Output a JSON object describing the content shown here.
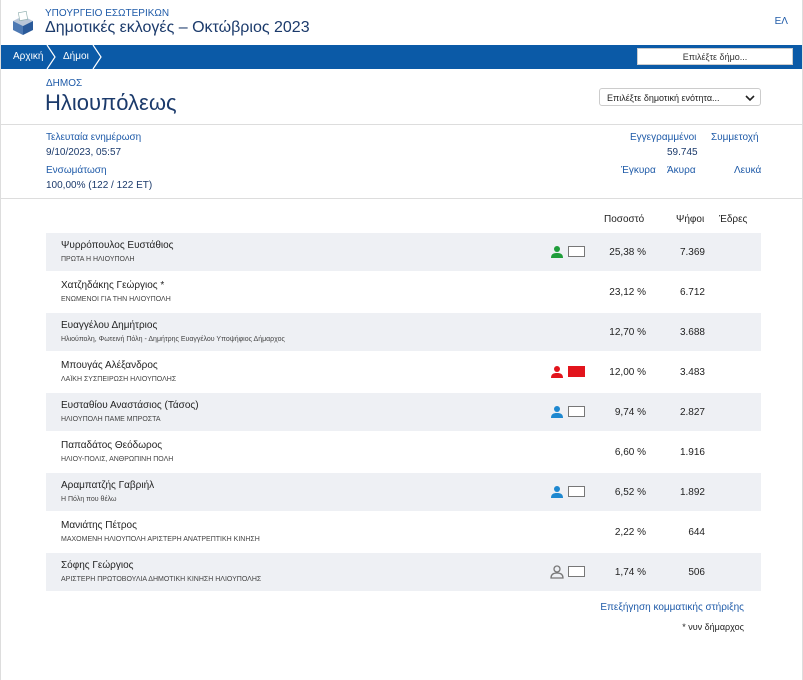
{
  "header": {
    "ministry": "ΥΠΟΥΡΓΕΙΟ ΕΣΩΤΕΡΙΚΩΝ",
    "title": "Δημοτικές εκλογές – Οκτώβριος 2023",
    "lang": "ΕΛ",
    "logo_icon": "ballot-box-icon"
  },
  "nav": {
    "home": "Αρχική",
    "municipalities": "Δήμοι",
    "select_municipality": "Επιλέξτε δήμο..."
  },
  "municipality": {
    "label": "ΔΗΜΟΣ",
    "name": "Ηλιουπόλεως",
    "unit_select": "Επιλέξτε δημοτική ενότητα..."
  },
  "stats": {
    "last_update_label": "Τελευταία ενημέρωση",
    "last_update_value": "9/10/2023, 05:57",
    "integration_label": "Ενσωμάτωση",
    "integration_value": "100,00% (122 / 122 ΕΤ)",
    "registered_label": "Εγγεγραμμένοι",
    "registered_value": "59.745",
    "turnout_label": "Συμμετοχή",
    "valid_label": "Έγκυρα",
    "invalid_label": "Άκυρα",
    "blank_label": "Λευκά"
  },
  "table": {
    "headers": {
      "percent": "Ποσοστό",
      "votes": "Ψήφοι",
      "seats": "Έδρες"
    },
    "rows": [
      {
        "name": "Ψυρρόπουλος Ευστάθιος",
        "party": "ΠΡΩΤΑ Η ΗΛΙΟΥΠΟΛΗ",
        "percent": "25,38 %",
        "votes": "7.369",
        "support": "green"
      },
      {
        "name": "Χατζηδάκης Γεώργιος *",
        "party": "ΕΝΩΜΕΝΟΙ ΓΙΑ ΤΗΝ ΗΛΙΟΥΠΟΛΗ",
        "percent": "23,12 %",
        "votes": "6.712",
        "support": "none"
      },
      {
        "name": "Ευαγγέλου Δημήτριος",
        "party": "Ηλιούπολη, Φωτεινή Πόλη - Δημήτρης Ευαγγέλου Υποψήφιος Δήμαρχος",
        "percent": "12,70 %",
        "votes": "3.688",
        "support": "none"
      },
      {
        "name": "Μπουγάς Αλέξανδρος",
        "party": "ΛΑΪΚΗ ΣΥΣΠΕΙΡΩΣΗ ΗΛΙΟΥΠΟΛΗΣ",
        "percent": "12,00 %",
        "votes": "3.483",
        "support": "red"
      },
      {
        "name": "Ευσταθίου Αναστάσιος (Τάσος)",
        "party": "ΗΛΙΟΥΠΟΛΗ ΠΑΜΕ ΜΠΡΟΣΤΑ",
        "percent": "9,74 %",
        "votes": "2.827",
        "support": "blue"
      },
      {
        "name": "Παπαδάτος Θεόδωρος",
        "party": "ΗΛΙΟΥ-ΠΟΛΙΣ, ΑΝΘΡΩΠΙΝΗ ΠΟΛΗ",
        "percent": "6,60 %",
        "votes": "1.916",
        "support": "none"
      },
      {
        "name": "Αραμπατζής Γαβριήλ",
        "party": "Η Πόλη που θέλω",
        "percent": "6,52 %",
        "votes": "1.892",
        "support": "blue"
      },
      {
        "name": "Μανιάτης Πέτρος",
        "party": "ΜΑΧΟΜΕΝΗ ΗΛΙΟΥΠΟΛΗ ΑΡΙΣΤΕΡΗ ΑΝΑΤΡΕΠΤΙΚΗ ΚΙΝΗΣΗ",
        "percent": "2,22 %",
        "votes": "644",
        "support": "none"
      },
      {
        "name": "Σόφης Γεώργιος",
        "party": "ΑΡΙΣΤΕΡΗ ΠΡΩΤΟΒΟΥΛΙΑ ΔΗΜΟΤΙΚΗ ΚΙΝΗΣΗ ΗΛΙΟΥΠΟΛΗΣ",
        "percent": "1,74 %",
        "votes": "506",
        "support": "outline"
      }
    ]
  },
  "footer": {
    "explanation_link": "Επεξήγηση κομματικής στήριξης",
    "note": "* νυν δήμαρχος"
  },
  "colors": {
    "brand": "#0b5aa7",
    "title": "#1b3a6b",
    "link": "#1e5aa8",
    "green": "#1f9d3a",
    "red": "#e2141c",
    "blue": "#1e88d0",
    "grey": "#777777"
  }
}
